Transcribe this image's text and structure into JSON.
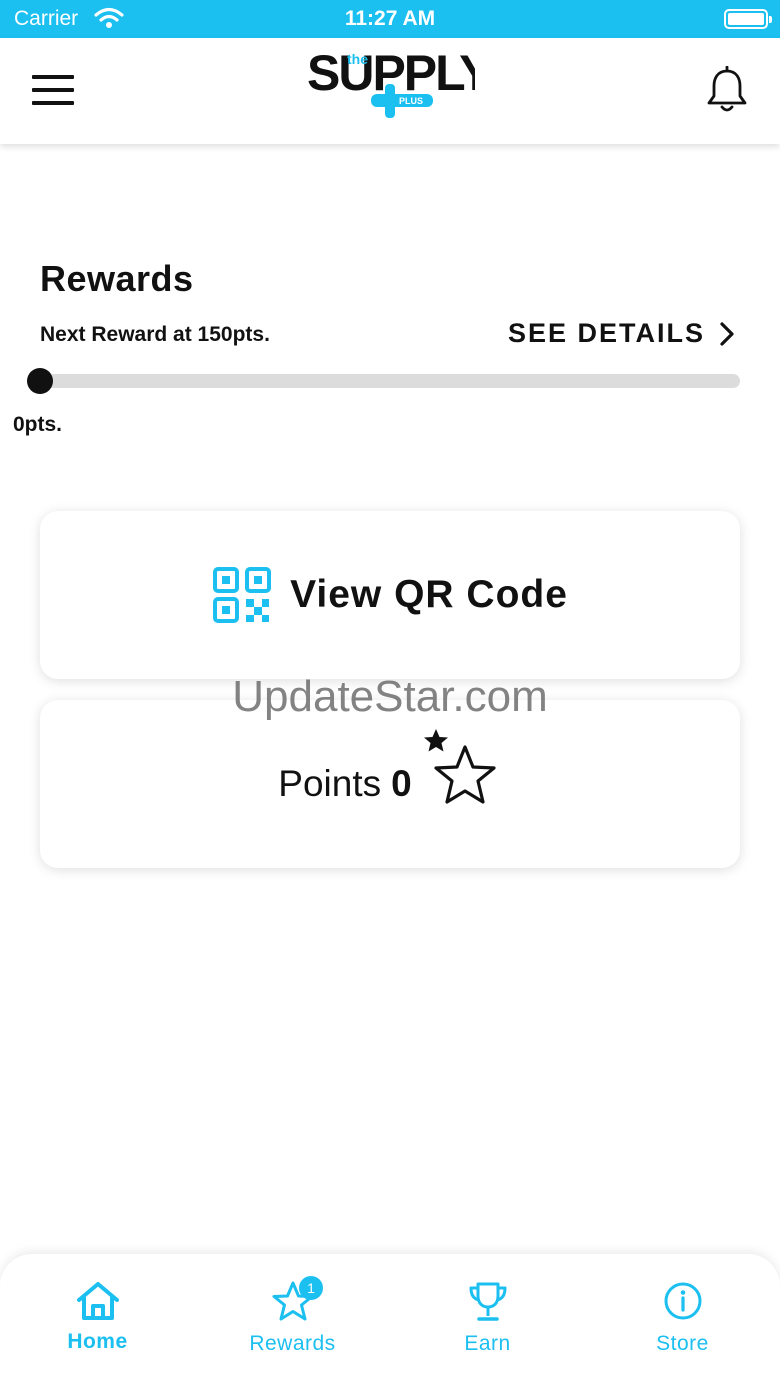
{
  "status_bar": {
    "carrier": "Carrier",
    "time": "11:27 AM"
  },
  "header": {
    "logo": {
      "the": "the",
      "supply": "SUPPLY",
      "plus": "PLUS"
    },
    "menu_icon": "hamburger-icon",
    "notification_icon": "bell-icon"
  },
  "rewards": {
    "title": "Rewards",
    "next_reward": "Next Reward at 150pts.",
    "see_details": "SEE DETAILS",
    "progress_fraction": 0,
    "current_points_label": "0pts."
  },
  "cards": {
    "qr_label": "View QR Code",
    "points_label": "Points",
    "points_value": "0"
  },
  "watermark": "UpdateStar.com",
  "tab_bar": {
    "tabs": [
      {
        "label": "Home",
        "icon": "home-icon",
        "active": true
      },
      {
        "label": "Rewards",
        "icon": "star-icon",
        "badge": "1",
        "active": false
      },
      {
        "label": "Earn",
        "icon": "trophy-icon",
        "active": false
      },
      {
        "label": "Store",
        "icon": "info-icon",
        "active": false
      }
    ]
  },
  "colors": {
    "accent": "#1bbff0",
    "text": "#111111",
    "track": "#dcdcdc"
  }
}
